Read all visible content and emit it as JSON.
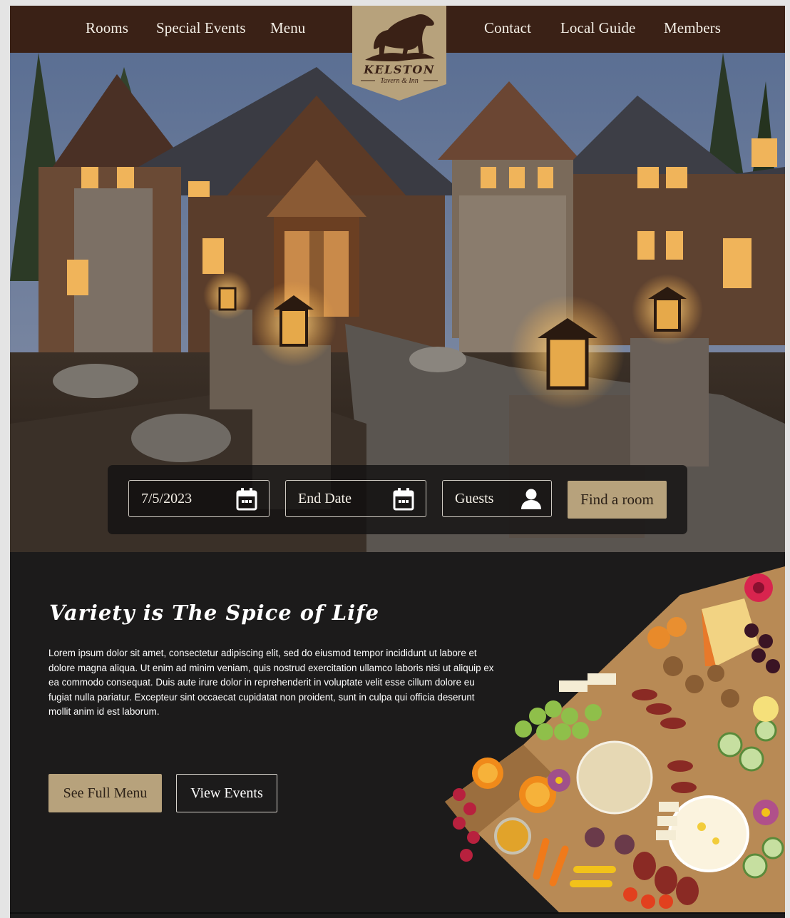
{
  "nav": {
    "left_items": [
      "Rooms",
      "Special Events",
      "Menu"
    ],
    "right_items": [
      "Contact",
      "Local Guide",
      "Members"
    ]
  },
  "logo": {
    "name": "KELSTON",
    "tagline": "Tavern & Inn",
    "icon": "bear-icon",
    "color": "#b7a27c"
  },
  "hero": {
    "image": "stone-and-timber-lodge-at-dusk"
  },
  "booking": {
    "start_date": "7/5/2023",
    "end_date_placeholder": "End Date",
    "guests_placeholder": "Guests",
    "find_button": "Find a room",
    "date_icon": "calendar-icon",
    "guests_icon": "person-icon"
  },
  "feature": {
    "heading": "Variety is The Spice of Life",
    "body": "Lorem ipsum dolor sit amet, consectetur adipiscing elit, sed do eiusmod tempor incididunt ut labore et dolore magna aliqua. Ut enim ad minim veniam, quis nostrud exercitation ullamco laboris nisi ut aliquip ex ea commodo consequat. Duis aute irure dolor in reprehenderit in voluptate velit esse cillum dolore eu fugiat nulla pariatur. Excepteur sint occaecat cupidatat non proident, sunt in culpa qui officia deserunt mollit anim id est laborum.",
    "primary_button": "See Full Menu",
    "secondary_button": "View Events",
    "image": "charcuterie-board"
  },
  "colors": {
    "nav_bg": "#3a2116",
    "accent": "#b7a27c",
    "content_bg": "#1c1b1b"
  }
}
